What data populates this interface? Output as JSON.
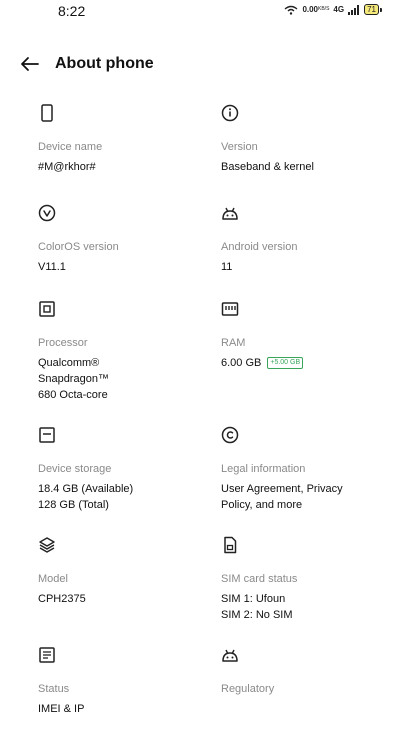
{
  "status_bar": {
    "time": "8:22",
    "net_speed": "0.00",
    "net_unit": "KB/S",
    "signal_label": "4G",
    "battery": "71"
  },
  "header": {
    "title": "About phone"
  },
  "items": [
    {
      "label": "Device name",
      "value": "#M@rkhor#",
      "icon": "phone-outline-icon"
    },
    {
      "label": "Version",
      "value": "Baseband & kernel",
      "icon": "info-circle-icon"
    },
    {
      "label": "ColorOS version",
      "value": "V11.1",
      "icon": "coloros-logo-icon"
    },
    {
      "label": "Android version",
      "value": "11",
      "icon": "android-icon"
    },
    {
      "label": "Processor",
      "value": "Qualcomm®\nSnapdragon™\n680 Octa-core",
      "icon": "processor-icon"
    },
    {
      "label": "RAM",
      "value": "6.00 GB",
      "badge": "+5.00 GB",
      "icon": "ram-icon"
    },
    {
      "label": "Device storage",
      "value": "18.4 GB (Available)\n128 GB (Total)",
      "icon": "storage-icon"
    },
    {
      "label": "Legal information",
      "value": "User Agreement, Privacy\nPolicy, and more",
      "icon": "copyright-icon"
    },
    {
      "label": "Model",
      "value": "CPH2375",
      "icon": "layers-icon"
    },
    {
      "label": "SIM card status",
      "value": "SIM 1: Ufoun\nSIM 2: No SIM",
      "icon": "sim-card-icon"
    },
    {
      "label": "Status",
      "value": "IMEI & IP",
      "icon": "status-list-icon"
    },
    {
      "label": "Regulatory",
      "value": "",
      "icon": "android-icon"
    }
  ]
}
